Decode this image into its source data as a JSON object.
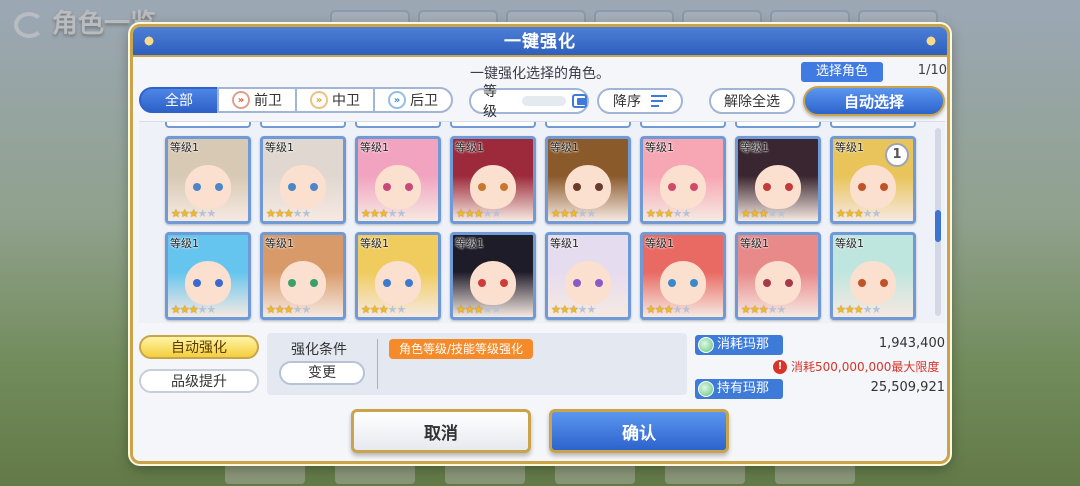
{
  "background": {
    "title": "角色一览"
  },
  "dialog": {
    "title": "一键强化",
    "subtitle": "一键强化选择的角色。",
    "select_label": "选择角色",
    "select_count": "1/10",
    "filters": [
      {
        "label": "全部",
        "active": true,
        "icon": ""
      },
      {
        "label": "前卫",
        "active": false,
        "icon": "vanguard-chevron-icon"
      },
      {
        "label": "中卫",
        "active": false,
        "icon": "midguard-chevron-icon"
      },
      {
        "label": "后卫",
        "active": false,
        "icon": "rearguard-chevron-icon"
      }
    ],
    "sort_level_label": "等级",
    "sort_order_label": "降序",
    "clear_all_label": "解除全选",
    "auto_select_label": "自动选择",
    "characters": [
      {
        "level": "等级1",
        "stars": 3,
        "selected_count": "",
        "hair": "#d8c9b4",
        "eye": "#4a86c9"
      },
      {
        "level": "等级1",
        "stars": 3,
        "selected_count": "",
        "hair": "#e0d8d0",
        "eye": "#4a86c9"
      },
      {
        "level": "等级1",
        "stars": 3,
        "selected_count": "",
        "hair": "#f2a3c0",
        "eye": "#c74a7a"
      },
      {
        "level": "等级1",
        "stars": 3,
        "selected_count": "",
        "hair": "#9c2a3a",
        "eye": "#c9772a"
      },
      {
        "level": "等级1",
        "stars": 3,
        "selected_count": "",
        "hair": "#8b5a2b",
        "eye": "#6a3a2a"
      },
      {
        "level": "等级1",
        "stars": 3,
        "selected_count": "",
        "hair": "#f7a6b3",
        "eye": "#d14a6a"
      },
      {
        "level": "等级1",
        "stars": 3,
        "selected_count": "",
        "hair": "#3a2630",
        "eye": "#c23a3a"
      },
      {
        "level": "等级1",
        "stars": 3,
        "selected_count": "1",
        "hair": "#e9c45a",
        "eye": "#c2522a"
      },
      {
        "level": "等级1",
        "stars": 3,
        "selected_count": "",
        "hair": "#66c5ee",
        "eye": "#3a6ad1"
      },
      {
        "level": "等级1",
        "stars": 3,
        "selected_count": "",
        "hair": "#d99a6a",
        "eye": "#3aa06a"
      },
      {
        "level": "等级1",
        "stars": 3,
        "selected_count": "",
        "hair": "#f0cc5e",
        "eye": "#3a7ad1"
      },
      {
        "level": "等级1",
        "stars": 3,
        "selected_count": "",
        "hair": "#1f1c2a",
        "eye": "#d13a3a"
      },
      {
        "level": "等级1",
        "stars": 3,
        "selected_count": "",
        "hair": "#e6dcef",
        "eye": "#8a5ac9"
      },
      {
        "level": "等级1",
        "stars": 3,
        "selected_count": "",
        "hair": "#e86a62",
        "eye": "#3a8ac9"
      },
      {
        "level": "等级1",
        "stars": 3,
        "selected_count": "",
        "hair": "#e8898a",
        "eye": "#a63a4a"
      },
      {
        "level": "等级1",
        "stars": 3,
        "selected_count": "",
        "hair": "#bfe6de",
        "eye": "#c2522a"
      }
    ],
    "mode_auto_label": "自动强化",
    "mode_rank_label": "品级提升",
    "condition_label": "强化条件",
    "change_label": "变更",
    "condition_chip": "角色等级/技能等级强化",
    "mana_cost_label": "消耗玛那",
    "mana_cost_value": "1,943,400",
    "mana_warning": "消耗500,000,000最大限度",
    "mana_owned_label": "持有玛那",
    "mana_owned_value": "25,509,921",
    "cancel_label": "取消",
    "confirm_label": "确认"
  }
}
